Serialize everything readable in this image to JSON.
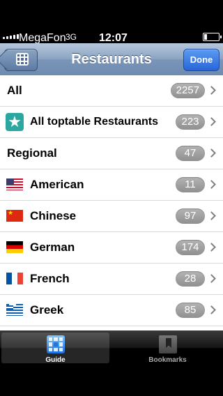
{
  "status_bar": {
    "carrier": "MegaFon",
    "network": "3G",
    "time": "12:07"
  },
  "nav": {
    "title": "Restaurants",
    "done_label": "Done"
  },
  "rows": [
    {
      "label": "All",
      "count": "2257",
      "icon": "none"
    },
    {
      "label": "All toptable Restaurants",
      "count": "223",
      "icon": "star-icon"
    },
    {
      "label": "Regional",
      "count": "47",
      "icon": "none"
    },
    {
      "label": "American",
      "count": "11",
      "icon": "us-flag-icon"
    },
    {
      "label": "Chinese",
      "count": "97",
      "icon": "china-flag-icon"
    },
    {
      "label": "German",
      "count": "174",
      "icon": "germany-flag-icon"
    },
    {
      "label": "French",
      "count": "28",
      "icon": "france-flag-icon"
    },
    {
      "label": "Greek",
      "count": "85",
      "icon": "greece-flag-icon"
    }
  ],
  "tabs": {
    "guide_label": "Guide",
    "bookmarks_label": "Bookmarks"
  },
  "colors": {
    "nav_bar": "#7a95b8",
    "done_button": "#2866d8",
    "badge": "#9a9a9a",
    "star_icon_bg": "#2aa7a0"
  }
}
